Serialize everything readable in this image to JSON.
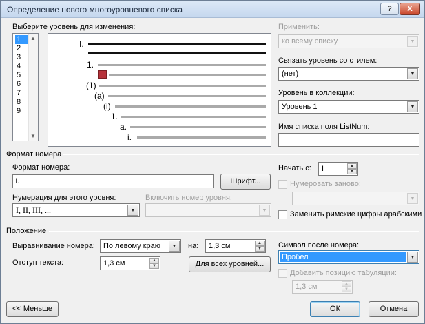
{
  "window": {
    "title": "Определение нового многоуровневого списка",
    "help_label": "?",
    "close_label": "X"
  },
  "level_select": {
    "label": "Выберите уровень для изменения:",
    "items": [
      "1",
      "2",
      "3",
      "4",
      "5",
      "6",
      "7",
      "8",
      "9"
    ],
    "selected": "1"
  },
  "preview": {
    "markers": [
      "I.",
      "1.",
      "(1)",
      "(a)",
      "(i)",
      "1.",
      "a.",
      "i."
    ]
  },
  "apply": {
    "label": "Применить:",
    "value": "ко всему списку"
  },
  "link_style": {
    "label": "Связать уровень со стилем:",
    "value": "(нет)"
  },
  "gallery_level": {
    "label": "Уровень в коллекции:",
    "value": "Уровень 1"
  },
  "listnum": {
    "label": "Имя списка поля ListNum:",
    "value": ""
  },
  "number_format": {
    "section_title": "Формат номера",
    "format_label": "Формат номера:",
    "format_value": "I.",
    "font_button": "Шрифт...",
    "style_label": "Нумерация для этого уровня:",
    "style_value": "I, II, III, ...",
    "include_label": "Включить номер уровня:",
    "include_value": "",
    "start_label": "Начать с:",
    "start_value": "I",
    "restart_label": "Нумеровать заново:",
    "restart_value": "",
    "legal_label": "Заменить римские цифры арабскими"
  },
  "position": {
    "section_title": "Положение",
    "align_label": "Выравнивание номера:",
    "align_value": "По левому краю",
    "at_label": "на:",
    "at_value": "1,3 см",
    "indent_label": "Отступ текста:",
    "indent_value": "1,3 см",
    "all_levels_button": "Для всех уровней...",
    "follow_label": "Символ после номера:",
    "follow_value": "Пробел",
    "tab_label": "Добавить позицию табуляции:",
    "tab_value": "1,3 см"
  },
  "footer": {
    "less_button": "<< Меньше",
    "ok_button": "ОК",
    "cancel_button": "Отмена"
  },
  "icons": {
    "dropdown": "▼",
    "spin_up": "▲",
    "spin_down": "▼",
    "scroll_up": "▲",
    "scroll_down": "▼"
  }
}
